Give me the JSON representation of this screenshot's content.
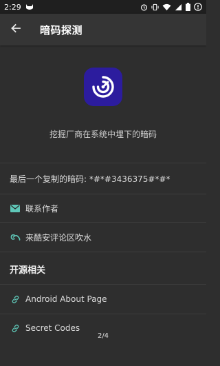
{
  "status_bar": {
    "time": "2:29"
  },
  "app_bar": {
    "title": "暗码探测"
  },
  "hero": {
    "tagline": "挖掘厂商在系统中埋下的暗码"
  },
  "last_copied": {
    "label": "最后一个复制的暗码: *#*#3436375#*#*"
  },
  "contact": {
    "label": "联系作者"
  },
  "coolapk": {
    "label": "来酷安评论区吹水"
  },
  "open_source": {
    "title": "开源相关",
    "items": [
      {
        "label": "Android About Page"
      },
      {
        "label": "Secret Codes"
      }
    ]
  },
  "pager": {
    "indicator": "2/4"
  },
  "colors": {
    "accent": "#5fc7b8",
    "logo_bg": "#2c1c9e",
    "background": "#2e2e2e"
  }
}
